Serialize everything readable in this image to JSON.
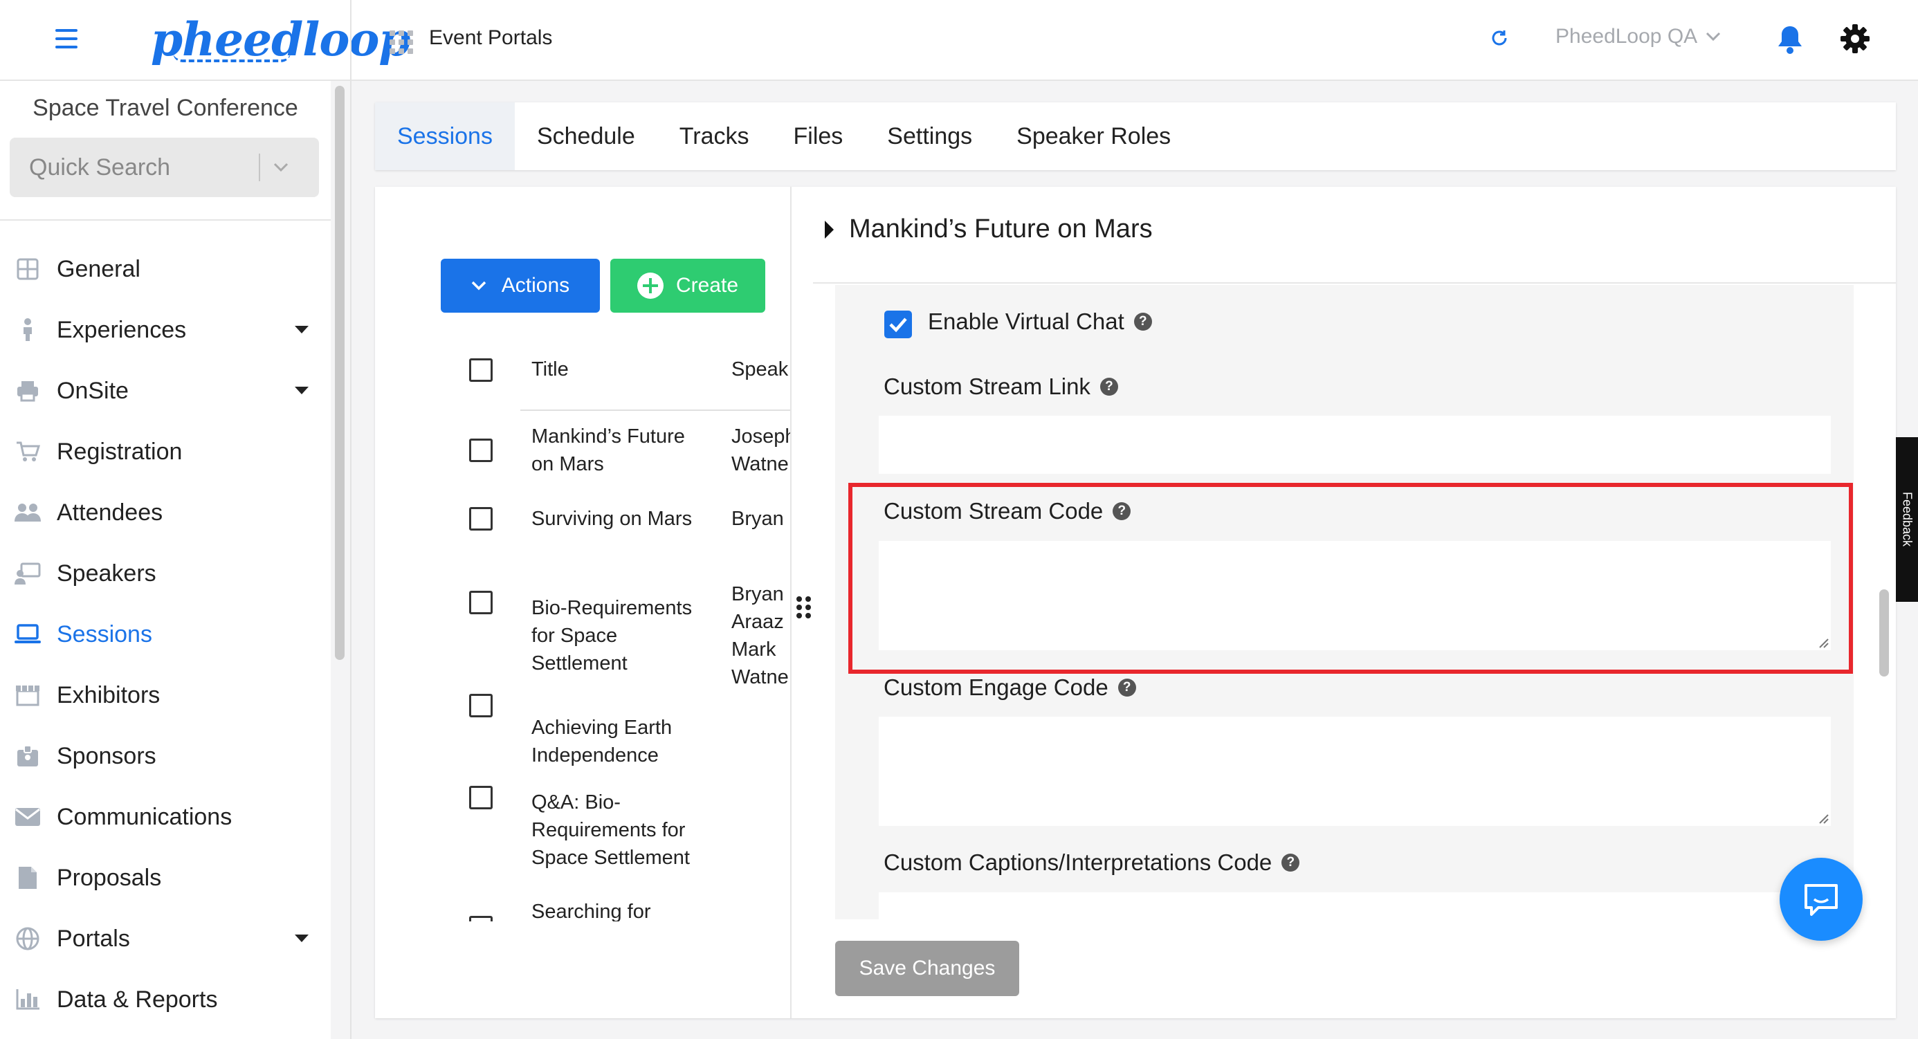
{
  "topbar": {
    "logo_text": "pheedloop",
    "section_label": "Event Portals",
    "org_name": "PheedLoop QA",
    "icons": [
      "hamburger-menu-icon",
      "apps-grid-icon",
      "refresh-icon",
      "chevron-down-icon",
      "bell-icon",
      "gear-icon"
    ],
    "accent_color": "#1a73e8"
  },
  "sidebar": {
    "event_title": "Space Travel Conference",
    "search_placeholder": "Quick Search",
    "items": [
      {
        "label": "General",
        "icon": "grid-icon",
        "has_submenu": false
      },
      {
        "label": "Experiences",
        "icon": "person-icon",
        "has_submenu": true
      },
      {
        "label": "OnSite",
        "icon": "printer-icon",
        "has_submenu": true
      },
      {
        "label": "Registration",
        "icon": "cart-icon",
        "has_submenu": false
      },
      {
        "label": "Attendees",
        "icon": "people-icon",
        "has_submenu": false
      },
      {
        "label": "Speakers",
        "icon": "presenter-icon",
        "has_submenu": false
      },
      {
        "label": "Sessions",
        "icon": "laptop-icon",
        "has_submenu": false,
        "active": true
      },
      {
        "label": "Exhibitors",
        "icon": "storefront-icon",
        "has_submenu": false
      },
      {
        "label": "Sponsors",
        "icon": "badge-icon",
        "has_submenu": false
      },
      {
        "label": "Communications",
        "icon": "envelope-icon",
        "has_submenu": false
      },
      {
        "label": "Proposals",
        "icon": "document-icon",
        "has_submenu": false
      },
      {
        "label": "Portals",
        "icon": "globe-icon",
        "has_submenu": true
      },
      {
        "label": "Data & Reports",
        "icon": "bar-chart-icon",
        "has_submenu": false
      }
    ]
  },
  "tabs": [
    {
      "label": "Sessions",
      "active": true
    },
    {
      "label": "Schedule"
    },
    {
      "label": "Tracks"
    },
    {
      "label": "Files"
    },
    {
      "label": "Settings"
    },
    {
      "label": "Speaker Roles"
    }
  ],
  "session_list": {
    "actions_label": "Actions",
    "create_label": "Create",
    "columns": [
      "Title",
      "Speak"
    ],
    "rows": [
      {
        "title_lines": [
          "Mankind’s Future",
          "on Mars"
        ],
        "speaker_lines": [
          "Joseph",
          "Watne"
        ]
      },
      {
        "title_lines": [
          "Surviving on Mars"
        ],
        "speaker_lines": [
          "Bryan"
        ]
      },
      {
        "title_lines": [
          "Bio-Requirements",
          "for Space",
          "Settlement"
        ],
        "speaker_lines": [
          "Bryan",
          "Araaz",
          "Mark",
          "Watne"
        ]
      },
      {
        "title_lines": [
          "Achieving Earth",
          "Independence"
        ],
        "speaker_lines": []
      },
      {
        "title_lines": [
          "Q&A: Bio-",
          "Requirements for",
          "Space Settlement"
        ],
        "speaker_lines": []
      },
      {
        "title_lines": [
          "Searching for"
        ],
        "speaker_lines": []
      }
    ]
  },
  "detail": {
    "session_title": "Mankind’s Future on Mars",
    "enable_virtual_chat": {
      "label": "Enable Virtual Chat",
      "checked": true
    },
    "custom_stream_link": {
      "label": "Custom Stream Link",
      "value": ""
    },
    "custom_stream_code": {
      "label": "Custom Stream Code",
      "value": ""
    },
    "custom_engage_code": {
      "label": "Custom Engage Code",
      "value": ""
    },
    "custom_captions_code": {
      "label": "Custom Captions/Interpretations Code",
      "value": ""
    },
    "help_glyph": "?",
    "save_label": "Save Changes",
    "highlight_color": "#e8272d"
  },
  "misc": {
    "feedback_tab_label": "Feedback",
    "chat_bubble_icon": "chat-bubble-icon"
  }
}
